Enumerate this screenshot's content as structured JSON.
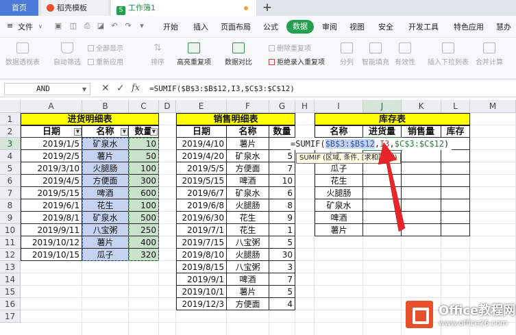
{
  "tabs": {
    "home": "首页",
    "template": "稻壳模板",
    "doc": "工作簿1",
    "doc_icon": "S",
    "add": "+"
  },
  "menu": {
    "file": "文件",
    "items": [
      "开始",
      "插入",
      "页面布局",
      "公式",
      "数据",
      "审阅",
      "视图",
      "安全",
      "开发工具",
      "特色应用",
      "慧办"
    ],
    "active": "数据"
  },
  "ribbon": {
    "pivot": "数据透视表",
    "autofilter": "自动筛选",
    "show_all": "全部显示",
    "reapply": "重新应用",
    "sort": "排序",
    "highlight_dup": "高亮重复项",
    "compare": "数据对比",
    "delete_dup": "删除重复项",
    "reject_dup": "拒绝录入重复项",
    "split": "分列",
    "smart_fill": "智能填充",
    "validity": "有效性",
    "dropdown": "插入下拉列表",
    "consolidate": "合并计算"
  },
  "formula_bar": {
    "name_box": "AND",
    "formula": "=SUMIF($B$3:$B$12,I3,$C$3:$C$12)"
  },
  "columns": [
    "A",
    "B",
    "C",
    "D",
    "E",
    "F",
    "G",
    "H",
    "I",
    "J",
    "K",
    "L",
    "M"
  ],
  "rows": [
    "1",
    "2",
    "3",
    "4",
    "5",
    "6",
    "7",
    "8",
    "9",
    "10",
    "11",
    "12",
    "13",
    "14",
    "15",
    "16",
    "17"
  ],
  "purchase": {
    "title": "进货明细表",
    "headers": [
      "日期",
      "名称",
      "数量"
    ],
    "rows": [
      [
        "2019/1/5",
        "矿泉水",
        "10"
      ],
      [
        "2019/2/5",
        "薯片",
        "50"
      ],
      [
        "2019/3/10",
        "火腿肠",
        "100"
      ],
      [
        "2019/4/5",
        "方便面",
        "300"
      ],
      [
        "2019/5/15",
        "啤酒",
        "600"
      ],
      [
        "2019/6/1",
        "花生",
        "100"
      ],
      [
        "2019/8/1",
        "矿泉水",
        "500"
      ],
      [
        "2019/9/11",
        "八宝粥",
        "250"
      ],
      [
        "2019/10/12",
        "薯片",
        "400"
      ],
      [
        "2019/10/15",
        "瓜子",
        "320"
      ]
    ]
  },
  "sales": {
    "title": "销售明细表",
    "headers": [
      "日期",
      "名称",
      "数量"
    ],
    "rows": [
      [
        "2019/4/10",
        "薯片",
        ""
      ],
      [
        "2019/4/20",
        "矿泉水",
        "5"
      ],
      [
        "2019/5/5",
        "方便面",
        "7"
      ],
      [
        "2019/5/15",
        "啤酒",
        "10"
      ],
      [
        "2019/6/7",
        "矿泉水",
        "6"
      ],
      [
        "2019/6/8",
        "火腿肠",
        "8"
      ],
      [
        "2019/6/30",
        "花生",
        "9"
      ],
      [
        "2019/7/1",
        "花生",
        "1"
      ],
      [
        "2019/7/15",
        "八宝粥",
        "5"
      ],
      [
        "2019/8/10",
        "火腿肠",
        "30"
      ],
      [
        "2019/8/15",
        "八宝粥",
        "3"
      ],
      [
        "2019/9/1",
        "啤酒",
        "7"
      ],
      [
        "2019/10/1",
        "薯片",
        "5"
      ],
      [
        "2019/12/3",
        "方便面",
        "4"
      ]
    ]
  },
  "inventory": {
    "title": "库存表",
    "headers": [
      "名称",
      "进货量",
      "销售量",
      "库存"
    ],
    "names": [
      "",
      "方便面",
      "瓜子",
      "花生",
      "火腿肠",
      "矿泉水",
      "啤酒",
      "薯片"
    ]
  },
  "cell_edit": {
    "prefix": "=SUMIF(",
    "arg1": "$B$3:$B$12",
    "arg2": "I3",
    "arg3": "$C$3:$C$12",
    "sep": ",",
    "close": ")"
  },
  "tooltip": "SUMIF (区域, 条件, [求和区域])",
  "watermark": {
    "brand": "Office教程网",
    "url": "www.office26.com"
  },
  "colors": {
    "accent_green": "#22a050",
    "title_yellow": "#ffff00",
    "range_blue": "#c5d3f1",
    "range_green": "#c9e2c9",
    "arrow_red": "#e8252a"
  }
}
